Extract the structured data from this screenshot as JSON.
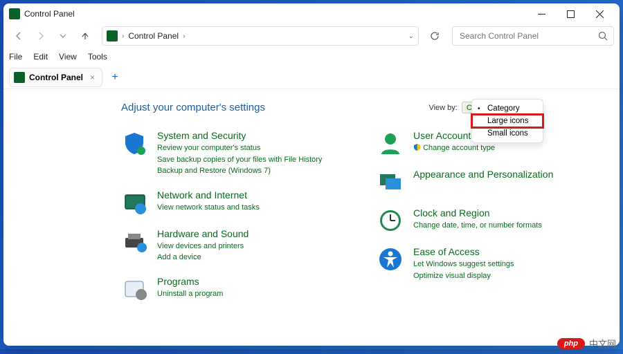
{
  "window": {
    "title": "Control Panel"
  },
  "nav": {
    "breadcrumb": "Control Panel"
  },
  "search": {
    "placeholder": "Search Control Panel"
  },
  "menu": [
    "File",
    "Edit",
    "View",
    "Tools"
  ],
  "tab": {
    "label": "Control Panel"
  },
  "page": {
    "heading": "Adjust your computer's settings",
    "viewby_label": "View by:",
    "viewby_value": "Category"
  },
  "dropdown": {
    "items": [
      "Category",
      "Large icons",
      "Small icons"
    ],
    "selected_index": 0,
    "highlighted_index": 1
  },
  "categories": {
    "left": [
      {
        "title": "System and Security",
        "links": [
          "Review your computer's status",
          "Save backup copies of your files with File History",
          "Backup and Restore (Windows 7)"
        ],
        "icon": "shield"
      },
      {
        "title": "Network and Internet",
        "links": [
          "View network status and tasks"
        ],
        "icon": "globe"
      },
      {
        "title": "Hardware and Sound",
        "links": [
          "View devices and printers",
          "Add a device"
        ],
        "icon": "printer"
      },
      {
        "title": "Programs",
        "links": [
          "Uninstall a program"
        ],
        "icon": "programs"
      }
    ],
    "right": [
      {
        "title": "User Accounts",
        "links": [
          "Change account type"
        ],
        "icon": "user",
        "link_shield": true
      },
      {
        "title": "Appearance and Personalization",
        "links": [],
        "icon": "appearance"
      },
      {
        "title": "Clock and Region",
        "links": [
          "Change date, time, or number formats"
        ],
        "icon": "clock"
      },
      {
        "title": "Ease of Access",
        "links": [
          "Let Windows suggest settings",
          "Optimize visual display"
        ],
        "icon": "ease"
      }
    ]
  },
  "watermark": {
    "pill": "php",
    "text": "中文网"
  }
}
